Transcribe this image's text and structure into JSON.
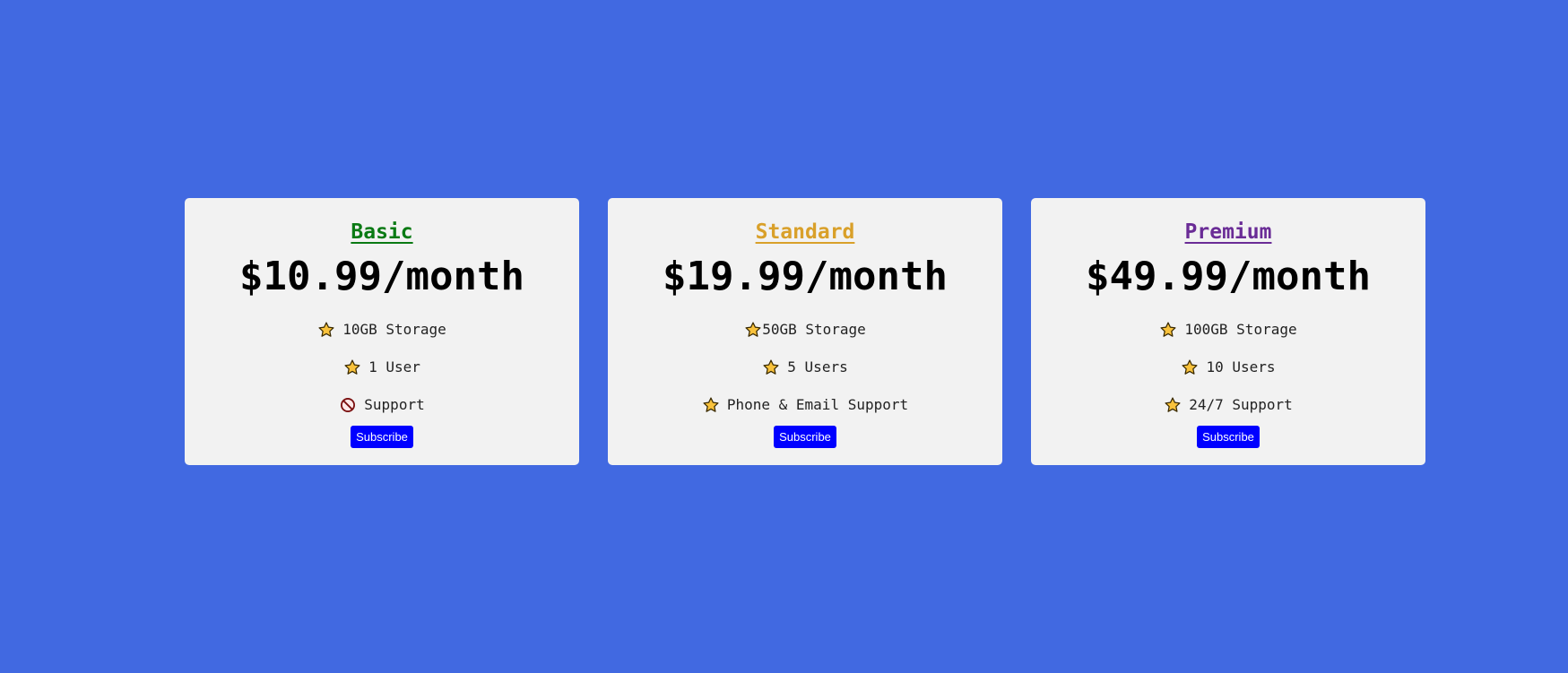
{
  "plans": [
    {
      "title": "Basic",
      "title_color": "#0a7a14",
      "price": "$10.99/month",
      "features": [
        {
          "icon": "star-icon",
          "text": "10GB Storage"
        },
        {
          "icon": "star-icon",
          "text": "1 User"
        },
        {
          "icon": "prohibited-icon",
          "text": "Support"
        }
      ],
      "button_label": "Subscribe"
    },
    {
      "title": "Standard",
      "title_color": "#d9a02a",
      "price": "$19.99/month",
      "features": [
        {
          "icon": "star-icon",
          "text": "50GB Storage"
        },
        {
          "icon": "star-icon",
          "text": "5 Users"
        },
        {
          "icon": "star-icon",
          "text": "Phone & Email Support"
        }
      ],
      "button_label": "Subscribe"
    },
    {
      "title": "Premium",
      "title_color": "#6a2c96",
      "price": "$49.99/month",
      "features": [
        {
          "icon": "star-icon",
          "text": "100GB Storage"
        },
        {
          "icon": "star-icon",
          "text": "10 Users"
        },
        {
          "icon": "star-icon",
          "text": "24/7 Support"
        }
      ],
      "button_label": "Subscribe"
    }
  ],
  "colors": {
    "background": "#4169e1",
    "card": "#f2f2f2",
    "button": "#0000ff",
    "star": "#f9c23c"
  }
}
